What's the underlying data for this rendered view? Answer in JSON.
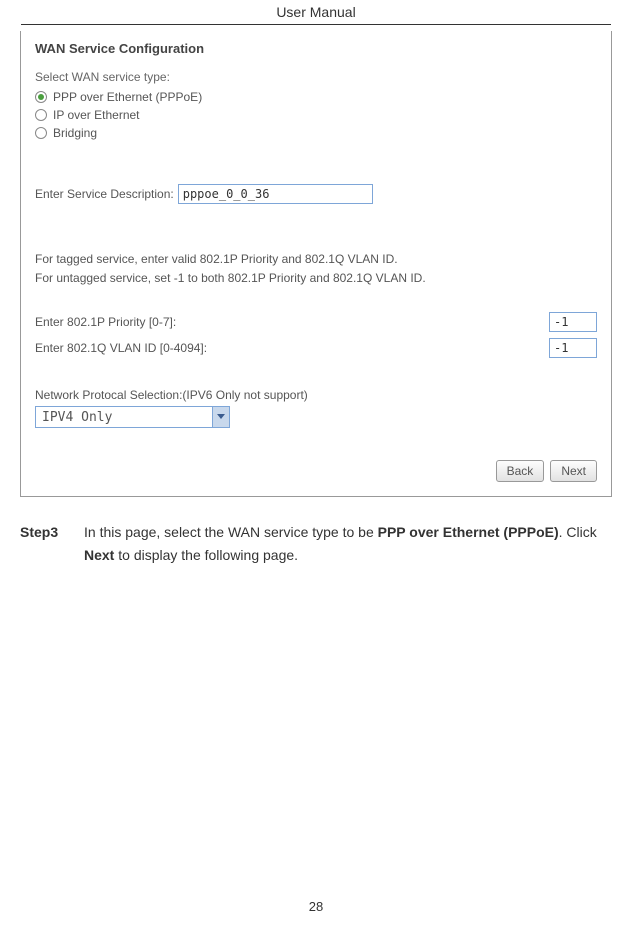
{
  "header": {
    "title": "User Manual"
  },
  "screenshot": {
    "config_title": "WAN Service Configuration",
    "select_type_label": "Select WAN service type:",
    "radios": [
      {
        "label": "PPP over Ethernet (PPPoE)",
        "selected": true
      },
      {
        "label": "IP over Ethernet",
        "selected": false
      },
      {
        "label": "Bridging",
        "selected": false
      }
    ],
    "service_desc_label": "Enter Service Description:",
    "service_desc_value": "pppoe_0_0_36",
    "tagged_line1": "For tagged service, enter valid 802.1P Priority and 802.1Q VLAN ID.",
    "tagged_line2": "For untagged service, set -1 to both 802.1P Priority and 802.1Q VLAN ID.",
    "priority_label": "Enter 802.1P Priority [0-7]:",
    "priority_value": "-1",
    "vlan_label": "Enter 802.1Q VLAN ID [0-4094]:",
    "vlan_value": "-1",
    "protocol_label": "Network Protocal Selection:(IPV6 Only not support)",
    "protocol_value": "IPV4 Only",
    "buttons": {
      "back": "Back",
      "next": "Next"
    }
  },
  "step": {
    "label": "Step3",
    "text_before": "In this page, select the WAN service type to be ",
    "bold1": "PPP over Ethernet (PPPoE)",
    "text_mid": ". Click ",
    "bold2": "Next",
    "text_after": " to display the following page."
  },
  "page_number": "28"
}
